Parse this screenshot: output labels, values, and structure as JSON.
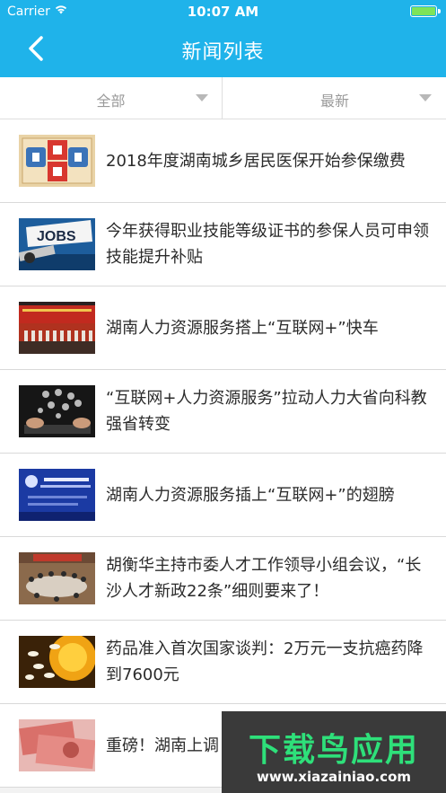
{
  "status_bar": {
    "carrier": "Carrier",
    "time": "10:07 AM",
    "battery_level": 1.0
  },
  "nav": {
    "title": "新闻列表",
    "back_icon": "chevron-left-icon"
  },
  "filters": {
    "category": "全部",
    "sort": "最新"
  },
  "news": [
    {
      "title": "2018年度湖南城乡居民医保开始参保缴费",
      "thumb": "medical-insurance-image"
    },
    {
      "title": "今年获得职业技能等级证书的参保人员可申领技能提升补贴",
      "thumb": "jobs-scissors-image"
    },
    {
      "title": "湖南人力资源服务搭上“互联网+”快车",
      "thumb": "conference-stage-image"
    },
    {
      "title": "“互联网+人力资源服务”拉动人力大省向科教强省转变",
      "thumb": "tablet-icons-image"
    },
    {
      "title": "湖南人力资源服务插上“互联网+”的翅膀",
      "thumb": "blue-conference-screen-image"
    },
    {
      "title": "胡衡华主持市委人才工作领导小组会议，“长沙人才新政22条”细则要来了！",
      "thumb": "meeting-room-image"
    },
    {
      "title": "药品准入首次国家谈判：2万元一支抗癌药降到7600元",
      "thumb": "pills-image"
    },
    {
      "title": "重磅！湖南上调",
      "thumb": "banknotes-image"
    }
  ],
  "watermark": {
    "text": "下载鸟应用",
    "url": "www.xiazainiao.com"
  },
  "colors": {
    "header": "#1fb3ea",
    "watermark_text": "#2ee07a"
  }
}
